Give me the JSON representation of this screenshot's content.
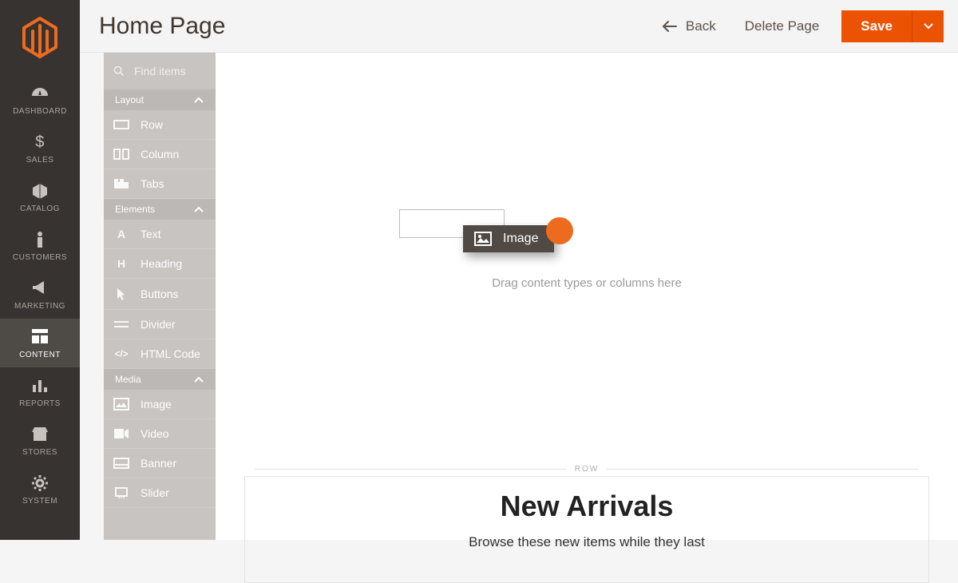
{
  "header": {
    "page_title": "Home Page",
    "back_label": "Back",
    "delete_label": "Delete Page",
    "save_label": "Save"
  },
  "nav": {
    "items": [
      {
        "label": "DASHBOARD"
      },
      {
        "label": "SALES"
      },
      {
        "label": "CATALOG"
      },
      {
        "label": "CUSTOMERS"
      },
      {
        "label": "MARKETING"
      },
      {
        "label": "CONTENT"
      },
      {
        "label": "REPORTS"
      },
      {
        "label": "STORES"
      },
      {
        "label": "SYSTEM"
      }
    ],
    "active_index": 5
  },
  "panel": {
    "search_placeholder": "Find items",
    "groups": [
      {
        "label": "Layout",
        "items": [
          {
            "label": "Row",
            "icon": "row-icon"
          },
          {
            "label": "Column",
            "icon": "column-icon"
          },
          {
            "label": "Tabs",
            "icon": "tabs-icon"
          }
        ]
      },
      {
        "label": "Elements",
        "items": [
          {
            "label": "Text",
            "icon": "text-icon"
          },
          {
            "label": "Heading",
            "icon": "heading-icon"
          },
          {
            "label": "Buttons",
            "icon": "buttons-icon"
          },
          {
            "label": "Divider",
            "icon": "divider-icon"
          },
          {
            "label": "HTML Code",
            "icon": "html-icon"
          }
        ]
      },
      {
        "label": "Media",
        "items": [
          {
            "label": "Image",
            "icon": "image-icon"
          },
          {
            "label": "Video",
            "icon": "video-icon"
          },
          {
            "label": "Banner",
            "icon": "banner-icon"
          },
          {
            "label": "Slider",
            "icon": "slider-icon"
          }
        ]
      }
    ]
  },
  "canvas": {
    "drag_chip_label": "Image",
    "drop_hint": "Drag content types or columns here",
    "row_label": "ROW",
    "row_title": "New Arrivals",
    "row_subtitle": "Browse these new items while they last"
  }
}
